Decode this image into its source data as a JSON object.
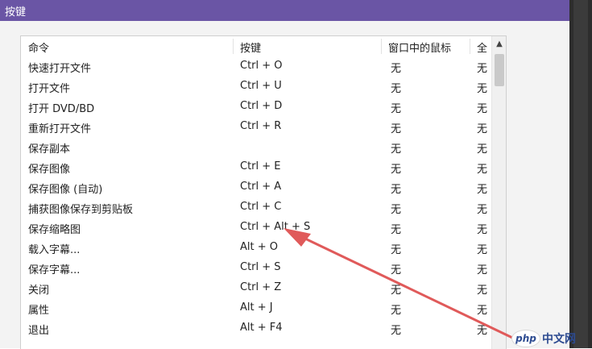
{
  "window": {
    "title": "按键"
  },
  "table": {
    "columns": [
      "命令",
      "按键",
      "窗口中的鼠标",
      "全"
    ],
    "rows": [
      {
        "command": "快速打开文件",
        "key": "Ctrl + O",
        "mouse_in_window": "无",
        "full": "无"
      },
      {
        "command": "打开文件",
        "key": "Ctrl + U",
        "mouse_in_window": "无",
        "full": "无"
      },
      {
        "command": "打开 DVD/BD",
        "key": "Ctrl + D",
        "mouse_in_window": "无",
        "full": "无"
      },
      {
        "command": "重新打开文件",
        "key": "Ctrl + R",
        "mouse_in_window": "无",
        "full": "无"
      },
      {
        "command": "保存副本",
        "key": "",
        "mouse_in_window": "无",
        "full": "无"
      },
      {
        "command": "保存图像",
        "key": "Ctrl + E",
        "mouse_in_window": "无",
        "full": "无"
      },
      {
        "command": "保存图像 (自动)",
        "key": "Ctrl + A",
        "mouse_in_window": "无",
        "full": "无"
      },
      {
        "command": "捕获图像保存到剪贴板",
        "key": "Ctrl + C",
        "mouse_in_window": "无",
        "full": "无"
      },
      {
        "command": "保存缩略图",
        "key": "Ctrl + Alt + S",
        "mouse_in_window": "无",
        "full": "无"
      },
      {
        "command": "载入字幕...",
        "key": "Alt + O",
        "mouse_in_window": "无",
        "full": "无"
      },
      {
        "command": "保存字幕...",
        "key": "Ctrl + S",
        "mouse_in_window": "无",
        "full": "无"
      },
      {
        "command": "关闭",
        "key": "Ctrl + Z",
        "mouse_in_window": "无",
        "full": "无"
      },
      {
        "command": "属性",
        "key": "Alt + J",
        "mouse_in_window": "无",
        "full": "无"
      },
      {
        "command": "退出",
        "key": "Alt + F4",
        "mouse_in_window": "无",
        "full": "无"
      }
    ]
  },
  "scrollbar": {
    "up_icon": "chevron-up-icon"
  },
  "annotation": {
    "arrow_color": "#e05a5a"
  },
  "watermark": {
    "logo_text": "php",
    "site_text": "中文网"
  },
  "colors": {
    "titlebar": "#6a55a5"
  }
}
